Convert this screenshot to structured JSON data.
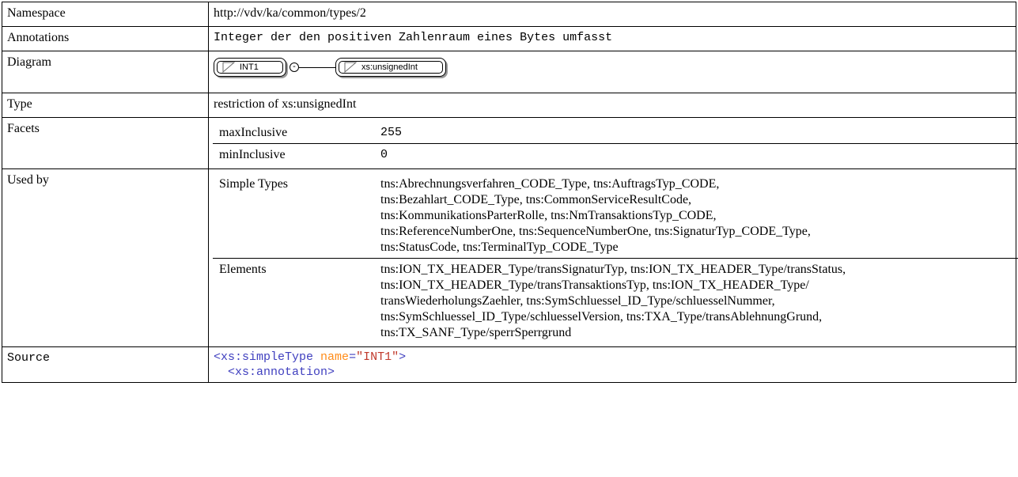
{
  "rows": {
    "namespace": {
      "label": "Namespace",
      "value": "http://vdv/ka/common/types/2"
    },
    "annotations": {
      "label": "Annotations",
      "value": "Integer der den positiven Zahlenraum eines Bytes umfasst"
    },
    "diagram": {
      "label": "Diagram",
      "node1": "INT1",
      "node2": "xs:unsignedInt",
      "collapse_symbol": "-"
    },
    "type": {
      "label": "Type",
      "value": "restriction of xs:unsignedInt"
    },
    "facets": {
      "label": "Facets",
      "items": [
        {
          "name": "maxInclusive",
          "value": "255"
        },
        {
          "name": "minInclusive",
          "value": "0"
        }
      ]
    },
    "used_by": {
      "label": "Used by",
      "groups": [
        {
          "name": "Simple Types",
          "lines": [
            "tns:Abrechnungsverfahren_CODE_Type, tns:AuftragsTyp_CODE,",
            "tns:Bezahlart_CODE_Type, tns:CommonServiceResultCode,",
            "tns:KommunikationsParterRolle, tns:NmTransaktionsTyp_CODE,",
            "tns:ReferenceNumberOne, tns:SequenceNumberOne, tns:SignaturTyp_CODE_Type,",
            "tns:StatusCode, tns:TerminalTyp_CODE_Type"
          ]
        },
        {
          "name": "Elements",
          "lines": [
            "tns:ION_TX_HEADER_Type/transSignaturTyp, tns:ION_TX_HEADER_Type/transStatus,",
            "tns:ION_TX_HEADER_Type/transTransaktionsTyp, tns:ION_TX_HEADER_Type/",
            "transWiederholungsZaehler, tns:SymSchluessel_ID_Type/schluesselNummer,",
            "tns:SymSchluessel_ID_Type/schluesselVersion, tns:TXA_Type/transAblehnungGrund,",
            "tns:TX_SANF_Type/sperrSperrgrund"
          ]
        }
      ]
    },
    "source": {
      "label": "Source",
      "line1": {
        "open": "<xs:simpleType",
        "attr": "name",
        "eq": "=",
        "val": "\"INT1\"",
        "close": ">"
      },
      "line2": "  <xs:annotation>"
    }
  },
  "colors": {
    "tag": "#3f3fbf",
    "attr": "#ff8c1a",
    "value": "#c0392b",
    "border": "#000000"
  },
  "icons": {
    "node": "simple-type-triangle-icon"
  }
}
